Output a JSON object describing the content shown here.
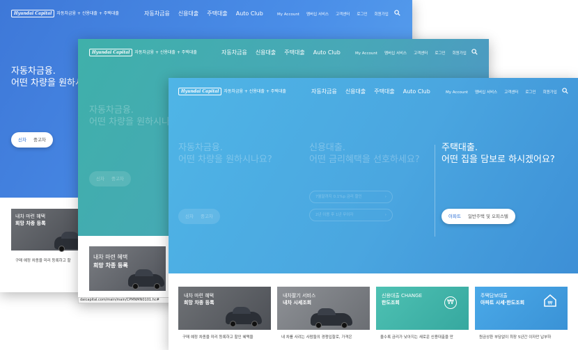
{
  "nav": {
    "logo": "Hyundai Capital",
    "logo_sub": "자동차금융 + 신용대출 + 주택대출",
    "menu": [
      "자동차금융",
      "신용대출",
      "주택대출",
      "Auto Club"
    ],
    "util": [
      "My Account",
      "멤버십 서비스",
      "고객센터",
      "로그인",
      "회원가입"
    ]
  },
  "hero": {
    "auto": {
      "line1": "자동차금융.",
      "line2": "어떤 차량을 원하시나요?",
      "tab_new": "신차",
      "tab_used": "중고차"
    },
    "credit": {
      "line1": "신용대출.",
      "line2": "어떤 금리혜택을 선호하세요?",
      "chip1": "7월말까지 0.1%p 금리 할인",
      "chip2": "2년 이용 후 1년 무이자"
    },
    "mortgage": {
      "line1": "주택대출.",
      "line2": "어떤 집을 담보로 하시겠어요?",
      "tab_apt": "아파트",
      "tab_house": "일반주택 및 오피스텔"
    }
  },
  "cards": [
    {
      "tag": "내차 마련 혜택",
      "title": "희망 차종 등록",
      "desc": "구매 예정 차종을 미리 등록하고 할인 혜택을"
    },
    {
      "tag": "내차팔기 서비스",
      "title": "내차 시세조회",
      "desc": "내 차를 사려는 사람들의 경쟁입찰로, 가격은"
    },
    {
      "tag": "신용대출 CHANGE",
      "title": "한도조회",
      "desc": "올수록 금리가 낮아지는 새로운 신용대출을 만"
    },
    {
      "tag": "주택담보대출",
      "title": "아파트 시세·한도조회",
      "desc": "원금상환 부담없이 최장 5년간 이자만 납부하"
    }
  ],
  "back_card_desc": "구매 예정 차종을 미리 등록하고 할",
  "status_url": "daicapital.com/main/main/CPMNMN0101.hc#",
  "colors": {
    "accent": "#2a6fd6",
    "teal": "#3fb0aa",
    "blue": "#4aa6e0"
  }
}
